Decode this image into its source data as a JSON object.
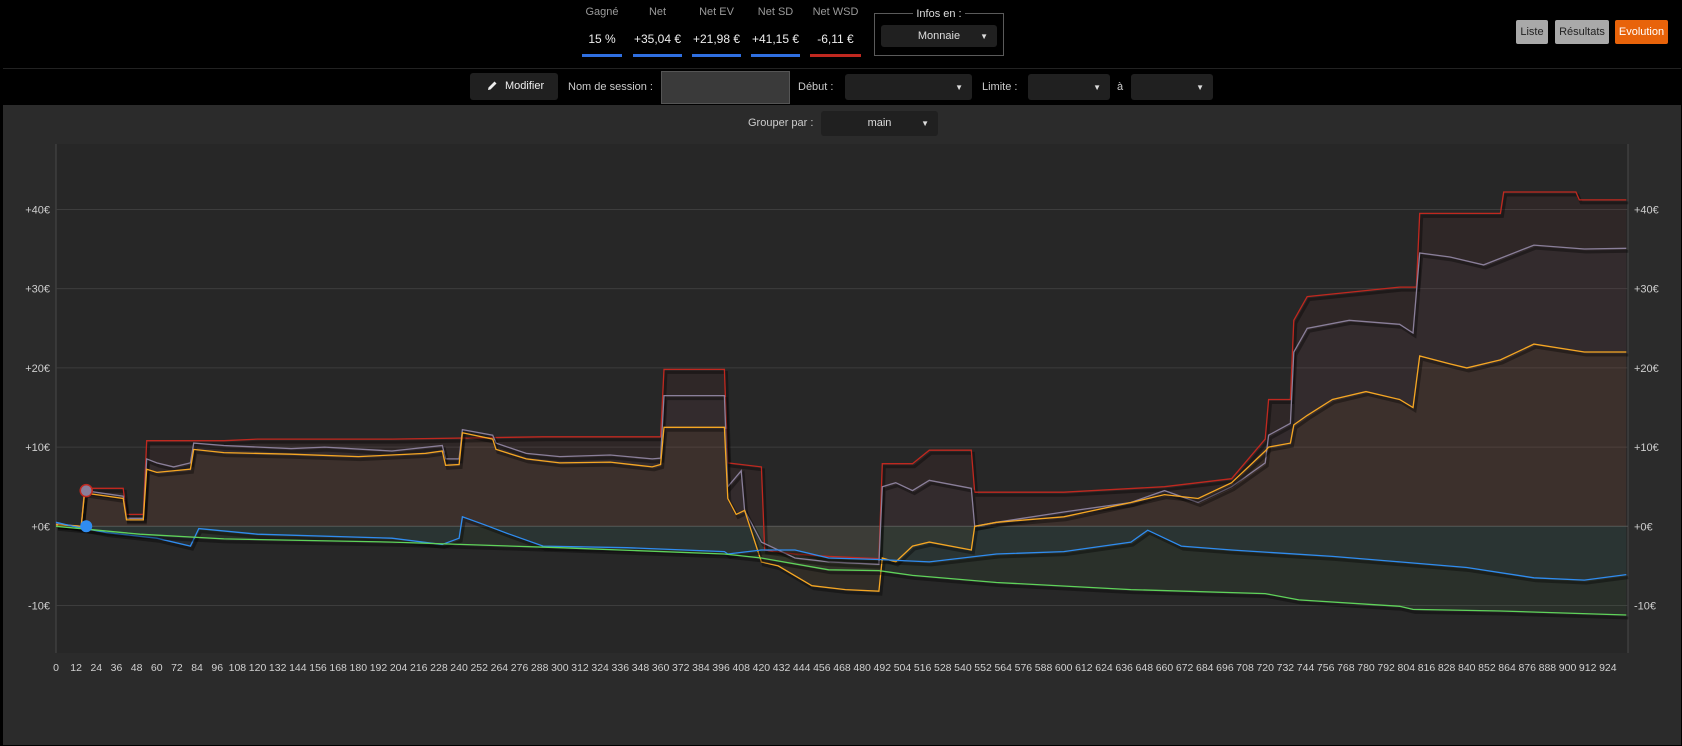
{
  "stats": [
    {
      "label": "Gagné",
      "value": "15 %",
      "color": "#2f6fe0"
    },
    {
      "label": "Net",
      "value": "+35,04 €",
      "color": "#2f6fe0"
    },
    {
      "label": "Net EV",
      "value": "+21,98 €",
      "color": "#2f6fe0"
    },
    {
      "label": "Net SD",
      "value": "+41,15 €",
      "color": "#2f6fe0"
    },
    {
      "label": "Net WSD",
      "value": "-6,11 €",
      "color": "#c0281f"
    }
  ],
  "infos": {
    "label": "Infos en :",
    "value": "Monnaie"
  },
  "tabs": {
    "list": "Liste",
    "results": "Résultats",
    "evolution": "Evolution"
  },
  "toolbar": {
    "modify": "Modifier",
    "session_label": "Nom de session :",
    "start_label": "Début :",
    "limit_label": "Limite :",
    "to_label": "à",
    "group_label": "Grouper par :",
    "group_value": "main"
  },
  "colors": {
    "accent": "#e8630a",
    "net": "#8a7f9a",
    "ev": "#f5a623",
    "sd": "#c0281f",
    "wsd": "#2f8cf0",
    "rake": "#5fd35a"
  },
  "chart_data": {
    "type": "line",
    "xlim": [
      0,
      936
    ],
    "ylim": [
      -16,
      47
    ],
    "x_ticks": [
      0,
      12,
      24,
      36,
      48,
      60,
      72,
      84,
      96,
      108,
      120,
      132,
      144,
      156,
      168,
      180,
      192,
      204,
      216,
      228,
      240,
      252,
      264,
      276,
      288,
      300,
      312,
      324,
      336,
      348,
      360,
      372,
      384,
      396,
      408,
      420,
      432,
      444,
      456,
      468,
      480,
      492,
      504,
      516,
      528,
      540,
      552,
      564,
      576,
      588,
      600,
      612,
      624,
      636,
      648,
      660,
      672,
      684,
      696,
      708,
      720,
      732,
      744,
      756,
      768,
      780,
      792,
      804,
      816,
      828,
      840,
      852,
      864,
      876,
      888,
      900,
      912,
      924
    ],
    "y_ticks": [
      {
        "v": 40,
        "label": "+40€"
      },
      {
        "v": 30,
        "label": "+30€"
      },
      {
        "v": 20,
        "label": "+20€"
      },
      {
        "v": 10,
        "label": "+10€"
      },
      {
        "v": 0,
        "label": "+0€"
      },
      {
        "v": -10,
        "label": "-10€"
      }
    ],
    "series": [
      {
        "color": "#c0281f",
        "points": [
          [
            0,
            0.2
          ],
          [
            15,
            0
          ],
          [
            17,
            4.8
          ],
          [
            40,
            4.8
          ],
          [
            42,
            1.5
          ],
          [
            52,
            1.5
          ],
          [
            54,
            10.8
          ],
          [
            100,
            10.8
          ],
          [
            120,
            11
          ],
          [
            200,
            11
          ],
          [
            290,
            11.3
          ],
          [
            360,
            11.3
          ],
          [
            362,
            19.8
          ],
          [
            398,
            19.8
          ],
          [
            400,
            8
          ],
          [
            420,
            7.5
          ],
          [
            422,
            -3
          ],
          [
            440,
            -3.5
          ],
          [
            460,
            -3.8
          ],
          [
            490,
            -4.1
          ],
          [
            492,
            7.9
          ],
          [
            510,
            7.9
          ],
          [
            520,
            9.6
          ],
          [
            545,
            9.6
          ],
          [
            547,
            4.3
          ],
          [
            600,
            4.3
          ],
          [
            660,
            5
          ],
          [
            700,
            6
          ],
          [
            720,
            11
          ],
          [
            722,
            16
          ],
          [
            735,
            16
          ],
          [
            737,
            26
          ],
          [
            745,
            29
          ],
          [
            800,
            30.2
          ],
          [
            810,
            30.2
          ],
          [
            812,
            39.5
          ],
          [
            860,
            39.5
          ],
          [
            862,
            42.2
          ],
          [
            905,
            42.2
          ],
          [
            907,
            41.2
          ],
          [
            935,
            41.2
          ]
        ]
      },
      {
        "color": "#8a7f9a",
        "points": [
          [
            0,
            0.3
          ],
          [
            15,
            0
          ],
          [
            17,
            4.5
          ],
          [
            40,
            3.8
          ],
          [
            42,
            1
          ],
          [
            52,
            1
          ],
          [
            54,
            8.5
          ],
          [
            60,
            8
          ],
          [
            70,
            7.5
          ],
          [
            80,
            8
          ],
          [
            82,
            10.5
          ],
          [
            100,
            10.2
          ],
          [
            140,
            9.8
          ],
          [
            160,
            10
          ],
          [
            200,
            9.5
          ],
          [
            230,
            10.2
          ],
          [
            232,
            8.5
          ],
          [
            240,
            8.5
          ],
          [
            242,
            12.2
          ],
          [
            260,
            11.5
          ],
          [
            262,
            10.5
          ],
          [
            280,
            9.2
          ],
          [
            300,
            8.8
          ],
          [
            330,
            9
          ],
          [
            355,
            8.5
          ],
          [
            360,
            8.6
          ],
          [
            362,
            16.5
          ],
          [
            398,
            16.5
          ],
          [
            400,
            5
          ],
          [
            408,
            7
          ],
          [
            410,
            2
          ],
          [
            420,
            -2
          ],
          [
            430,
            -3
          ],
          [
            440,
            -4
          ],
          [
            460,
            -4.5
          ],
          [
            490,
            -4.8
          ],
          [
            492,
            5
          ],
          [
            500,
            5.5
          ],
          [
            510,
            4.5
          ],
          [
            520,
            5.8
          ],
          [
            545,
            4.8
          ],
          [
            547,
            0
          ],
          [
            560,
            0.5
          ],
          [
            600,
            1.8
          ],
          [
            640,
            3
          ],
          [
            660,
            4.5
          ],
          [
            680,
            3
          ],
          [
            700,
            5
          ],
          [
            720,
            8
          ],
          [
            722,
            11.5
          ],
          [
            735,
            13
          ],
          [
            737,
            22
          ],
          [
            745,
            25
          ],
          [
            770,
            26
          ],
          [
            800,
            25.5
          ],
          [
            808,
            24.4
          ],
          [
            812,
            34.5
          ],
          [
            830,
            34
          ],
          [
            850,
            33
          ],
          [
            880,
            35.5
          ],
          [
            910,
            35
          ],
          [
            935,
            35.1
          ]
        ]
      },
      {
        "color": "#f5a623",
        "points": [
          [
            0,
            0.2
          ],
          [
            15,
            0
          ],
          [
            17,
            4.2
          ],
          [
            40,
            3.5
          ],
          [
            42,
            0.8
          ],
          [
            52,
            0.8
          ],
          [
            54,
            7.2
          ],
          [
            60,
            6.8
          ],
          [
            80,
            7.2
          ],
          [
            82,
            9.7
          ],
          [
            100,
            9.3
          ],
          [
            140,
            9.1
          ],
          [
            180,
            8.8
          ],
          [
            220,
            9.2
          ],
          [
            230,
            9.5
          ],
          [
            232,
            7.7
          ],
          [
            240,
            7.8
          ],
          [
            242,
            11.8
          ],
          [
            260,
            11
          ],
          [
            262,
            9.7
          ],
          [
            280,
            8.5
          ],
          [
            300,
            8
          ],
          [
            330,
            8.1
          ],
          [
            355,
            7.5
          ],
          [
            360,
            7.8
          ],
          [
            362,
            12.5
          ],
          [
            398,
            12.5
          ],
          [
            400,
            3.5
          ],
          [
            405,
            1.5
          ],
          [
            410,
            2
          ],
          [
            420,
            -4.5
          ],
          [
            430,
            -5
          ],
          [
            450,
            -7.5
          ],
          [
            470,
            -8
          ],
          [
            490,
            -8.2
          ],
          [
            492,
            -4
          ],
          [
            500,
            -4.5
          ],
          [
            510,
            -2.5
          ],
          [
            520,
            -2
          ],
          [
            545,
            -3
          ],
          [
            547,
            0
          ],
          [
            560,
            0.5
          ],
          [
            600,
            1.2
          ],
          [
            640,
            3
          ],
          [
            660,
            4
          ],
          [
            680,
            3.5
          ],
          [
            700,
            5.5
          ],
          [
            720,
            9.5
          ],
          [
            722,
            10
          ],
          [
            735,
            10.5
          ],
          [
            737,
            12.8
          ],
          [
            745,
            14
          ],
          [
            760,
            16
          ],
          [
            780,
            17
          ],
          [
            800,
            16
          ],
          [
            808,
            15
          ],
          [
            812,
            21.5
          ],
          [
            830,
            20.5
          ],
          [
            840,
            20
          ],
          [
            860,
            21
          ],
          [
            880,
            23
          ],
          [
            910,
            22
          ],
          [
            935,
            22
          ]
        ]
      },
      {
        "color": "#2f8cf0",
        "points": [
          [
            0,
            0.5
          ],
          [
            10,
            0
          ],
          [
            30,
            -0.8
          ],
          [
            60,
            -1.5
          ],
          [
            80,
            -2.5
          ],
          [
            85,
            -0.3
          ],
          [
            120,
            -1
          ],
          [
            200,
            -1.5
          ],
          [
            230,
            -2.3
          ],
          [
            240,
            -1.5
          ],
          [
            242,
            1.2
          ],
          [
            255,
            0.2
          ],
          [
            270,
            -1
          ],
          [
            290,
            -2.5
          ],
          [
            340,
            -2.7
          ],
          [
            398,
            -3.2
          ],
          [
            400,
            -3.5
          ],
          [
            420,
            -3
          ],
          [
            440,
            -3
          ],
          [
            460,
            -4
          ],
          [
            490,
            -4.2
          ],
          [
            520,
            -4.5
          ],
          [
            560,
            -3.5
          ],
          [
            600,
            -3.2
          ],
          [
            640,
            -2
          ],
          [
            650,
            -0.5
          ],
          [
            670,
            -2.5
          ],
          [
            700,
            -3
          ],
          [
            760,
            -3.8
          ],
          [
            800,
            -4.5
          ],
          [
            840,
            -5.2
          ],
          [
            880,
            -6.5
          ],
          [
            910,
            -6.8
          ],
          [
            935,
            -6.1
          ]
        ]
      },
      {
        "color": "#5fd35a",
        "points": [
          [
            0,
            0
          ],
          [
            50,
            -1
          ],
          [
            100,
            -1.6
          ],
          [
            200,
            -2
          ],
          [
            300,
            -2.7
          ],
          [
            398,
            -3.5
          ],
          [
            420,
            -4
          ],
          [
            460,
            -5.5
          ],
          [
            490,
            -5.6
          ],
          [
            510,
            -6.2
          ],
          [
            560,
            -7.1
          ],
          [
            640,
            -8
          ],
          [
            720,
            -8.5
          ],
          [
            740,
            -9.3
          ],
          [
            800,
            -10.1
          ],
          [
            808,
            -10.5
          ],
          [
            860,
            -10.7
          ],
          [
            935,
            -11.2
          ]
        ]
      }
    ]
  }
}
